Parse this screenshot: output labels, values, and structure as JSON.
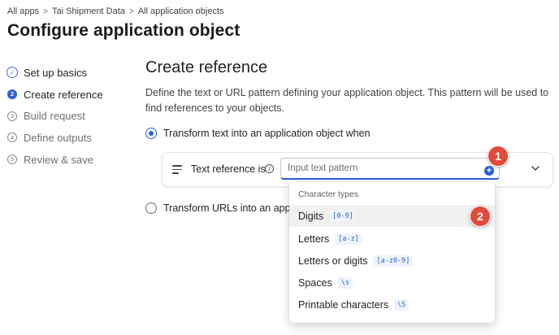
{
  "breadcrumb": {
    "items": [
      "All apps",
      "Tai Shipment Data",
      "All application objects"
    ],
    "separator": ">"
  },
  "page": {
    "title": "Configure application object"
  },
  "steps": [
    {
      "label": "Set up basics",
      "status": "done",
      "marker": "✓"
    },
    {
      "label": "Create reference",
      "status": "active",
      "marker": "2"
    },
    {
      "label": "Build request",
      "status": "pending",
      "marker": "3"
    },
    {
      "label": "Define outputs",
      "status": "pending",
      "marker": "4"
    },
    {
      "label": "Review & save",
      "status": "pending",
      "marker": "5"
    }
  ],
  "section": {
    "title": "Create reference",
    "description": "Define the text or URL pattern defining your application object. This pattern will be used to find references to your objects."
  },
  "options": {
    "text": {
      "label": "Transform text into an application object when",
      "selected": true
    },
    "urls": {
      "label": "Transform URLs into an applica",
      "selected": false
    }
  },
  "reference_row": {
    "label": "Text reference is",
    "info_glyph": "i",
    "input_placeholder": "Input text pattern",
    "input_value": "",
    "add_glyph": "+"
  },
  "dropdown": {
    "heading": "Character types",
    "items": [
      {
        "label": "Digits",
        "pattern": "[0-9]",
        "highlighted": true
      },
      {
        "label": "Letters",
        "pattern": "[a-z]",
        "highlighted": false
      },
      {
        "label": "Letters or digits",
        "pattern": "[a-z0-9]",
        "highlighted": false
      },
      {
        "label": "Spaces",
        "pattern": "\\s",
        "highlighted": false
      },
      {
        "label": "Printable characters",
        "pattern": "\\S",
        "highlighted": false
      }
    ]
  },
  "annotations": {
    "badge_1": "1",
    "badge_2": "2",
    "badge_color": "#e04a3a"
  },
  "colors": {
    "accent": "#2e5fd3",
    "text": "#242424",
    "muted": "#707070"
  }
}
